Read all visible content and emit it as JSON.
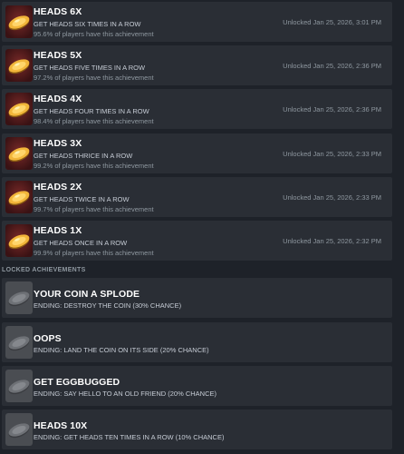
{
  "unlocked": [
    {
      "title": "HEADS 6X",
      "desc": "GET HEADS SIX TIMES IN A ROW",
      "pct": "95.6% of players have this achievement",
      "unlock": "Unlocked Jan 25, 2026, 3:01 PM"
    },
    {
      "title": "HEADS 5X",
      "desc": "GET HEADS FIVE TIMES IN A ROW",
      "pct": "97.2% of players have this achievement",
      "unlock": "Unlocked Jan 25, 2026, 2:36 PM"
    },
    {
      "title": "HEADS 4X",
      "desc": "GET HEADS FOUR TIMES IN A ROW",
      "pct": "98.4% of players have this achievement",
      "unlock": "Unlocked Jan 25, 2026, 2:36 PM"
    },
    {
      "title": "HEADS 3X",
      "desc": "GET HEADS THRICE IN A ROW",
      "pct": "99.2% of players have this achievement",
      "unlock": "Unlocked Jan 25, 2026, 2:33 PM"
    },
    {
      "title": "HEADS 2X",
      "desc": "GET HEADS TWICE IN A ROW",
      "pct": "99.7% of players have this achievement",
      "unlock": "Unlocked Jan 25, 2026, 2:33 PM"
    },
    {
      "title": "HEADS 1X",
      "desc": "GET HEADS ONCE IN A ROW",
      "pct": "99.9% of players have this achievement",
      "unlock": "Unlocked Jan 25, 2026, 2:32 PM"
    }
  ],
  "locked_header": "LOCKED ACHIEVEMENTS",
  "locked": [
    {
      "title": "YOUR COIN A SPLODE",
      "desc": "ENDING: DESTROY THE COIN (30% CHANCE)"
    },
    {
      "title": "OOPS",
      "desc": "ENDING: LAND THE COIN ON ITS SIDE (20% CHANCE)"
    },
    {
      "title": "GET EGGBUGGED",
      "desc": "ENDING: SAY HELLO TO AN OLD FRIEND (20% CHANCE)"
    },
    {
      "title": "HEADS 10X",
      "desc": "ENDING: GET HEADS TEN TIMES IN A ROW (10% CHANCE)"
    }
  ],
  "colors": {
    "background": "#1e2229",
    "row": "#2a2e35",
    "title": "#ffffff",
    "muted": "#8f98a0",
    "coin_gold": "#e3a42a",
    "icon_bg_unlocked": "#5a1e1e",
    "icon_bg_locked": "#4a4d52"
  },
  "icons": {
    "unlocked": "golden-coin-icon",
    "locked": "gray-coin-icon"
  }
}
